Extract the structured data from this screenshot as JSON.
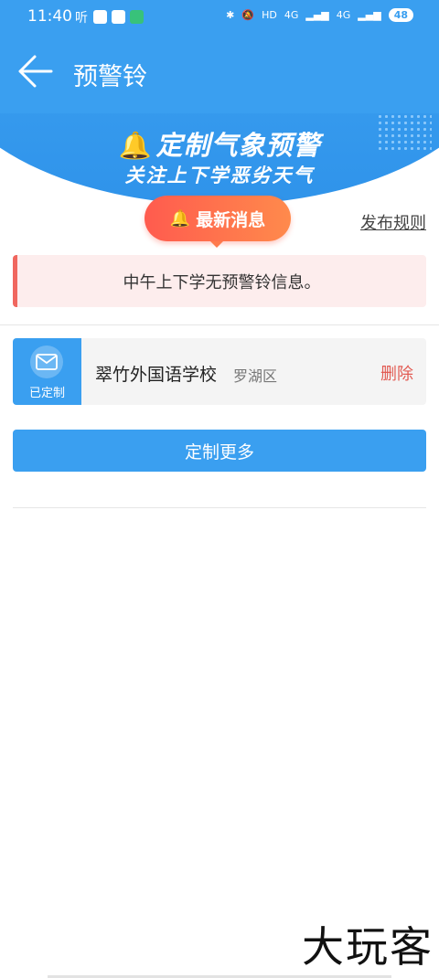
{
  "status_bar": {
    "time": "11:40",
    "app1": "听",
    "hd": "HD",
    "net1": "4G",
    "net2": "4G",
    "battery": "48",
    "icons": [
      "bluetooth-icon",
      "mute-icon",
      "signal-icon",
      "wifi-icon"
    ]
  },
  "header": {
    "back_icon": "arrow-left-icon",
    "title": "预警铃"
  },
  "banner": {
    "title": "定制气象预警",
    "subtitle": "关注上下学恶劣天气",
    "icon": "bell-icon"
  },
  "news": {
    "pill_label": "最新消息",
    "rules_link": "发布规则",
    "notice_text": "中午上下学无预警铃信息。"
  },
  "subscription": {
    "badge_label": "已定制",
    "school": "翠竹外国语学校",
    "district": "罗湖区",
    "delete_label": "删除"
  },
  "actions": {
    "customize_more": "定制更多"
  },
  "watermark": "大玩客",
  "colors": {
    "primary": "#3a9ff0",
    "alert": "#ff5b4e",
    "notice_bg": "#fdeded",
    "delete": "#e25a52"
  }
}
